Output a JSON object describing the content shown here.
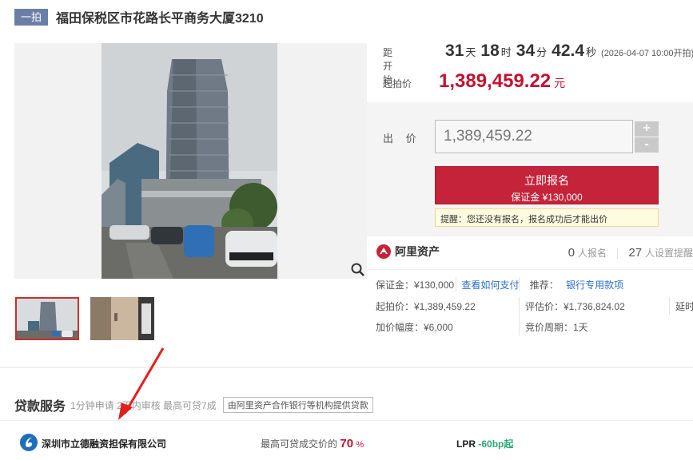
{
  "header": {
    "round_tag": "一拍",
    "title": "福田保税区市花路长平商务大厦3210"
  },
  "countdown": {
    "label": "距开始",
    "days": "31",
    "days_unit": "天",
    "hours": "18",
    "hours_unit": "时",
    "minutes": "34",
    "minutes_unit": "分",
    "seconds": "42.4",
    "seconds_unit": "秒",
    "start_note": "(2026-04-07 10:00开拍)"
  },
  "start_price": {
    "label": "起拍价",
    "value": "1,389,459.22",
    "unit": "元"
  },
  "bid": {
    "label": "出 价",
    "value": "1,389,459.22",
    "plus": "+",
    "minus": "-",
    "signup_label": "立即报名",
    "deposit_label": "保证金 ¥130,000",
    "tip": "提醒：您还没有报名，报名成功后才能出价"
  },
  "ali": {
    "name": "阿里资产",
    "signup_count": "0",
    "signup_suffix": "人报名",
    "reminder_count": "27",
    "reminder_suffix": "人设置提醒"
  },
  "info": {
    "deposit": "保证金：¥130,000",
    "how_to_pay": "查看如何支付",
    "recommend": "推荐：",
    "bank_loan": "银行专用款项",
    "start_price": "起拍价：¥1,389,459.22",
    "appraisal": "评估价：¥1,736,824.02",
    "delay": "延时",
    "increment": "加价幅度：¥6,000",
    "cycle": "竞价周期：1天"
  },
  "loan": {
    "title": "贷款服务",
    "subtitle": "1分钟申请 2天内审核 最高可贷7成",
    "badge": "由阿里资产合作银行等机构提供贷款",
    "company": "深圳市立德融资担保有限公司",
    "max_label": "最高可贷成交价的",
    "max_pct": "70",
    "max_unit": "%",
    "lpr_label": "LPR",
    "lpr_value": "-60bp起"
  },
  "colors": {
    "accent_red": "#c4233a",
    "price_red": "#c4112f",
    "link_blue": "#2b6fc5",
    "tag_blue": "#6b7fa6",
    "lpr_green": "#2ba672"
  }
}
